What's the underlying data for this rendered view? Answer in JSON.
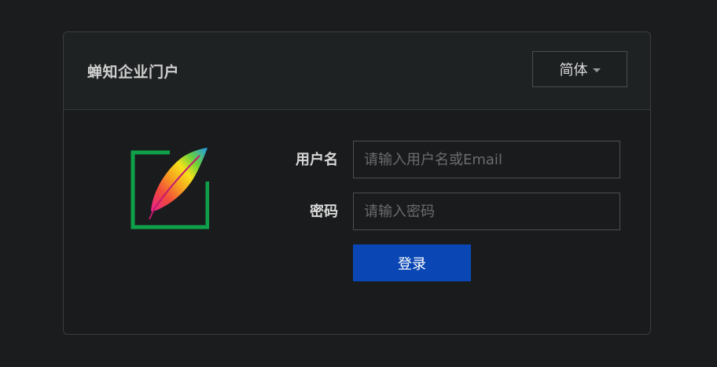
{
  "header": {
    "title": "蝉知企业门户",
    "language": {
      "selected": "简体"
    }
  },
  "login_form": {
    "username_label": "用户名",
    "username_placeholder": "请输入用户名或Email",
    "password_label": "密码",
    "password_placeholder": "请输入密码",
    "submit_label": "登录"
  },
  "logo": {
    "icon": "feather-logo-icon",
    "frame_color": "#0fa04a"
  },
  "colors": {
    "page_background": "#1b1c1e",
    "button_primary": "#0a47b4"
  }
}
